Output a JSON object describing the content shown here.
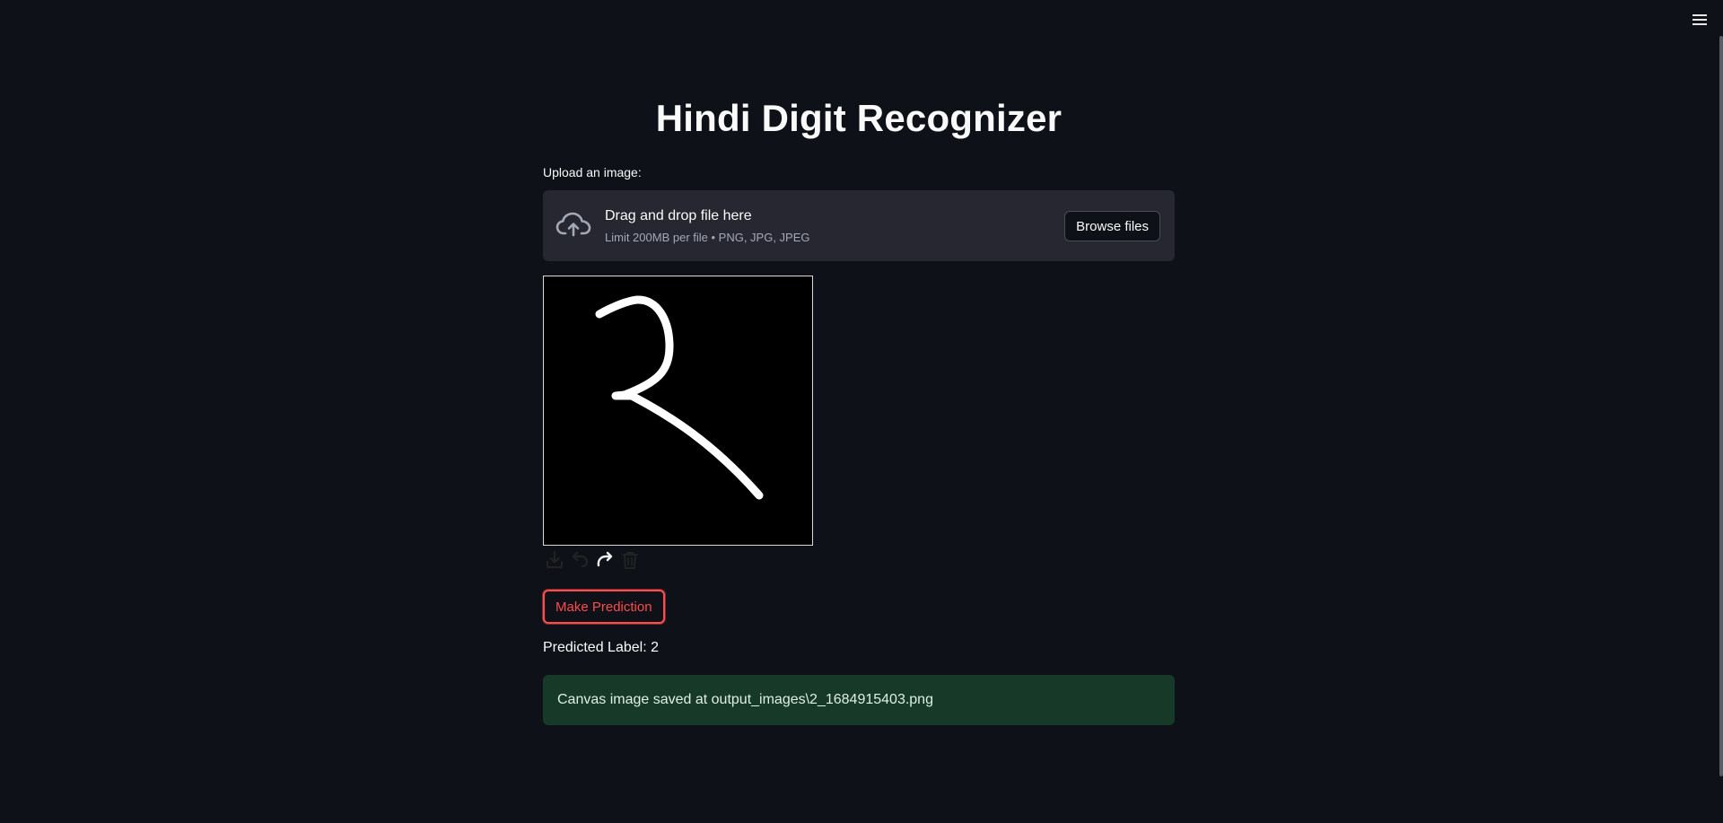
{
  "header": {
    "menu_icon": "hamburger-icon"
  },
  "main": {
    "title": "Hindi Digit Recognizer",
    "upload": {
      "label": "Upload an image:",
      "drop_title": "Drag and drop file here",
      "drop_subtitle": "Limit 200MB per file • PNG, JPG, JPEG",
      "browse_label": "Browse files",
      "icon": "cloud-upload-icon"
    },
    "canvas": {
      "background": "#000000",
      "stroke_color": "#ffffff",
      "drawn_digit": "2",
      "tools": [
        "download-icon",
        "undo-icon",
        "redo-icon",
        "trash-icon"
      ]
    },
    "predict_button_label": "Make Prediction",
    "prediction_text": "Predicted Label: 2",
    "success_message": "Canvas image saved at output_images\\2_1684915403.png"
  },
  "colors": {
    "background": "#0e1117",
    "dropzone": "#262730",
    "accent": "#ff4b4b",
    "success_bg": "#173928"
  }
}
